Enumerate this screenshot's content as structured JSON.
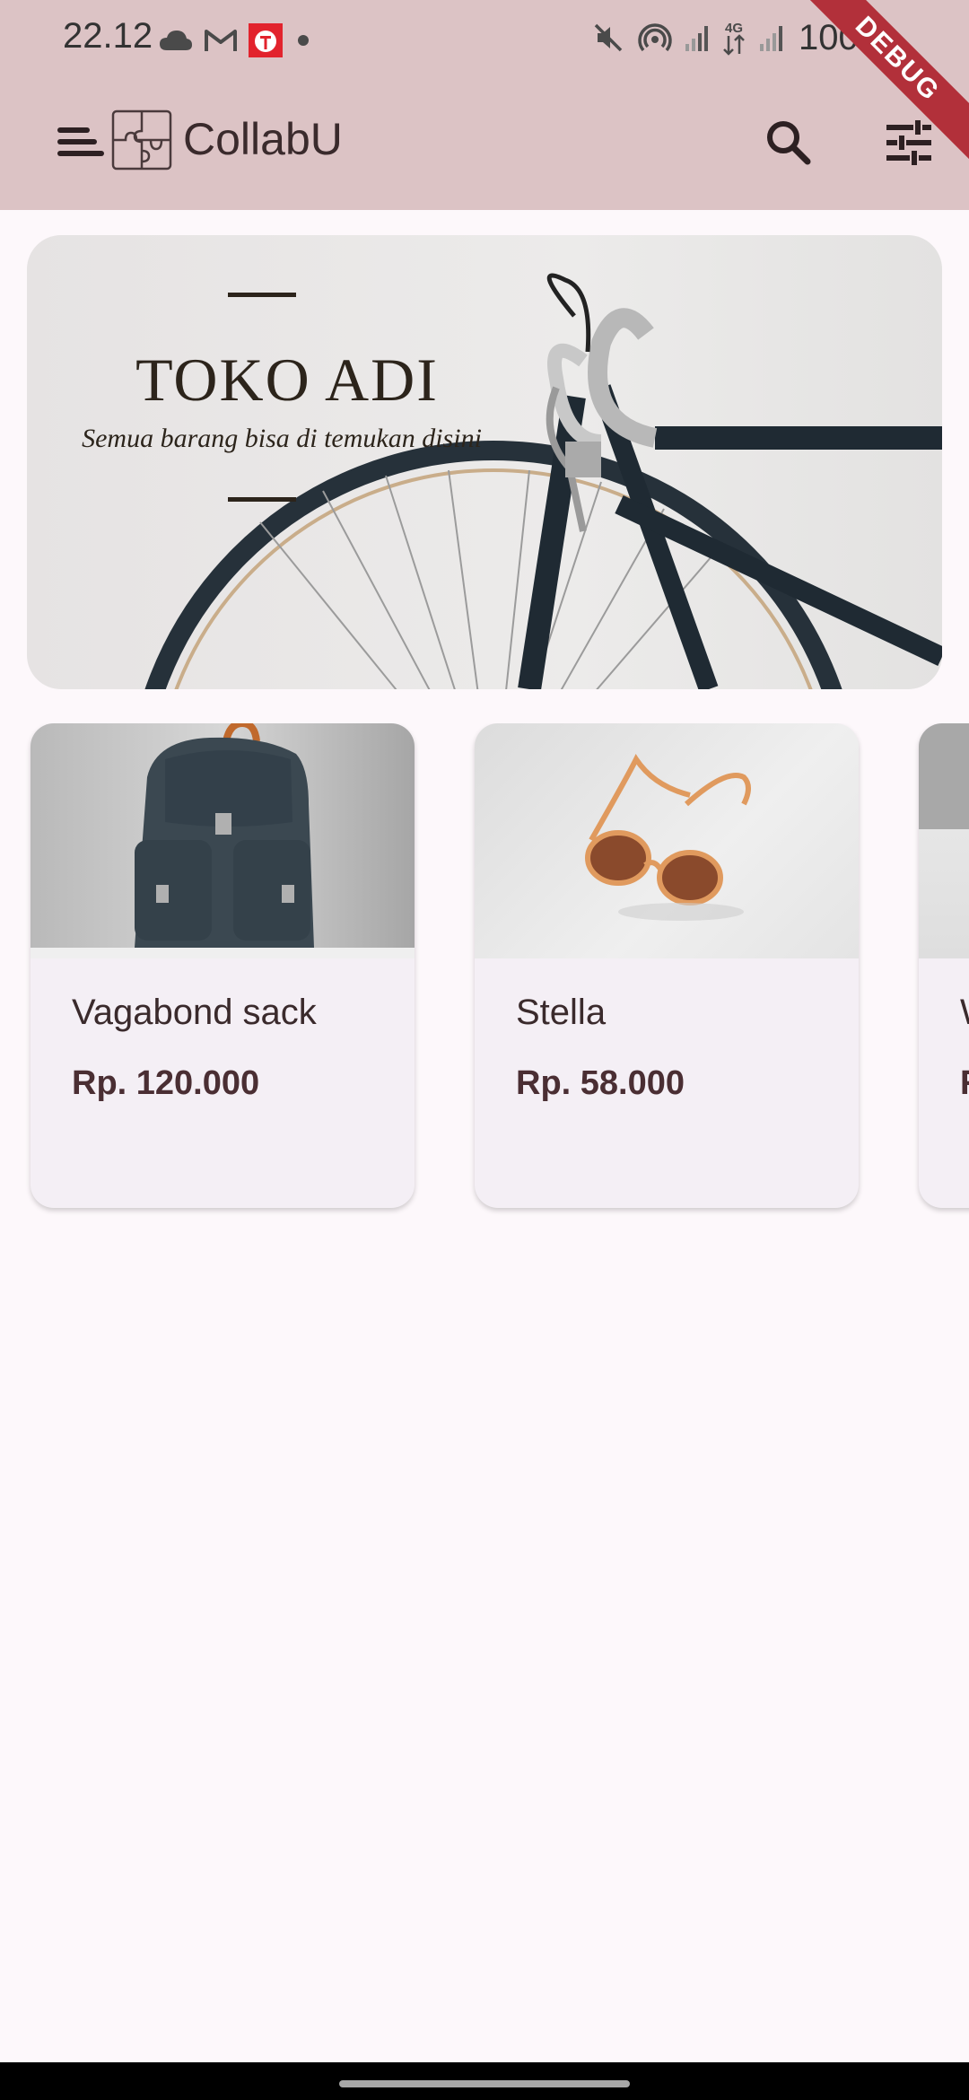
{
  "status_bar": {
    "time": "22.12",
    "battery": "100%",
    "network": "4G",
    "icons": [
      "cloud-icon",
      "gmail-icon",
      "app-notification-icon",
      "dot-icon",
      "mute-icon",
      "hotspot-icon",
      "signal-icon",
      "signal-icon",
      "battery-icon"
    ]
  },
  "debug_banner": "DEBUG",
  "app_bar": {
    "title": "CollabU",
    "menu_icon": "menu-icon",
    "logo_icon": "puzzle-logo-icon",
    "search_icon": "search-icon",
    "filter_icon": "tune-icon"
  },
  "banner": {
    "title": "TOKO ADI",
    "subtitle": "Semua barang bisa di temukan disini"
  },
  "products": [
    {
      "name": "Vagabond sack",
      "price": "Rp. 120.000",
      "image": "backpack-image"
    },
    {
      "name": "Stella",
      "price": "Rp. 58.000",
      "image": "sunglasses-image"
    },
    {
      "name": "W",
      "price": "R",
      "image": "product-image"
    }
  ],
  "colors": {
    "app_bar_bg": "#dcc3c5",
    "page_bg": "#fdf8fb",
    "card_bg": "#f4eff5",
    "text": "#3a2a2c",
    "debug_ribbon": "#b2303a"
  }
}
